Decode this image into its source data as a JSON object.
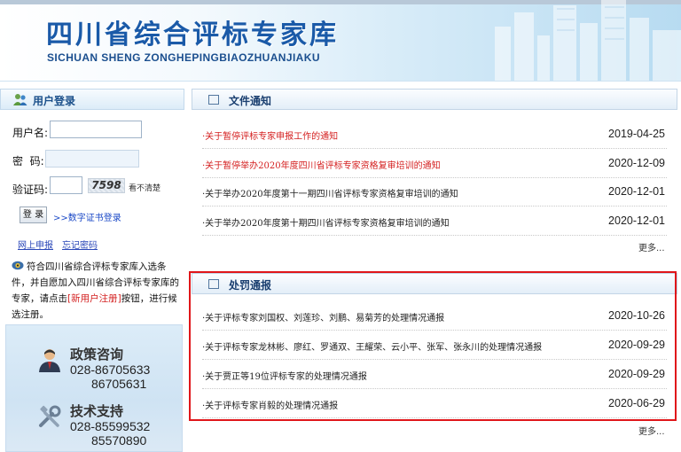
{
  "header": {
    "title": "四川省综合评标专家库",
    "subtitle": "SICHUAN SHENG ZONGHEPINGBIAOZHUANJIAKU"
  },
  "login": {
    "title": "用户登录",
    "username_label": "用户名:",
    "password_label": "密  码:",
    "captcha_label": "验证码:",
    "captcha_text": "7598",
    "captcha_refresh": "看不清楚",
    "submit_label": "登 录",
    "cert_link": ">>数字证书登录",
    "online_report": "网上申报",
    "forgot_password": "忘记密码",
    "notice_before": "符合四川省综合评标专家库入选条件，并自愿加入四川省综合评标专家库的专家，请点击",
    "notice_link": "[新用户注册]",
    "notice_after": "按钮，进行候选注册。"
  },
  "contacts": [
    {
      "title": "政策咨询",
      "phone1": "028-86705633",
      "phone2": "86705631",
      "icon": "consultant-icon"
    },
    {
      "title": "技术支持",
      "phone1": "028-85599532",
      "phone2": "85570890",
      "icon": "tools-icon"
    }
  ],
  "file_notices": {
    "title": "文件通知",
    "more": "更多...",
    "items": [
      {
        "title": "·关于暂停评标专家申报工作的通知",
        "date": "2019-04-25",
        "highlight": true
      },
      {
        "title": "·关于暂停举办2020年度四川省评标专家资格复审培训的通知",
        "date": "2020-12-09",
        "highlight": true
      },
      {
        "title": "·关于举办2020年度第十一期四川省评标专家资格复审培训的通知",
        "date": "2020-12-01",
        "highlight": false
      },
      {
        "title": "·关于举办2020年度第十期四川省评标专家资格复审培训的通知",
        "date": "2020-12-01",
        "highlight": false
      }
    ]
  },
  "penalty_notices": {
    "title": "处罚通报",
    "more": "更多...",
    "items": [
      {
        "title": "·关于评标专家刘国权、刘莲珍、刘鹏、易菊芳的处理情况通报",
        "date": "2020-10-26"
      },
      {
        "title": "·关于评标专家龙林彬、廖红、罗通双、王耀荣、云小平、张军、张永川的处理情况通报",
        "date": "2020-09-29"
      },
      {
        "title": "·关于贾正等19位评标专家的处理情况通报",
        "date": "2020-09-29"
      },
      {
        "title": "·关于评标专家肖毅的处理情况通报",
        "date": "2020-06-29"
      }
    ]
  },
  "colors": {
    "brand_blue": "#1a5aa8",
    "alert_red": "#e0161a",
    "link_blue": "#1b49c7"
  }
}
